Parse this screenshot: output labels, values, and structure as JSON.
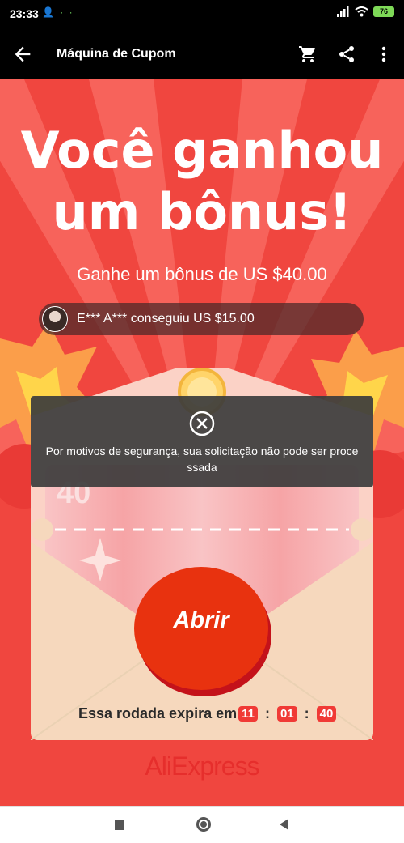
{
  "status_bar": {
    "time": "23:33",
    "notification_icons": "👤 · ·",
    "battery_level": "76"
  },
  "app_bar": {
    "title": "Máquina de Cupom",
    "back_icon": "arrow-left-icon",
    "cart_icon": "cart-icon",
    "share_icon": "share-icon",
    "more_icon": "more-vert-icon"
  },
  "hero": {
    "headline_line1": "Você ganhou",
    "headline_line2": "um bônus!",
    "subtitle": "Ganhe um bônus de US $40.00"
  },
  "ticker": {
    "message": "E*** A*** conseguiu US $15.00"
  },
  "coupon": {
    "value_partial": "40",
    "ghost_text": "... US $40.00"
  },
  "open_button": {
    "label": "Abrir"
  },
  "expiry": {
    "label": "Essa rodada expira em",
    "hours": "11",
    "minutes": "01",
    "seconds": "40",
    "separator": ":"
  },
  "brand": {
    "logo_text": "AliExpress"
  },
  "toast": {
    "icon": "close-circle-icon",
    "message": "Por motivos de segurança, sua solicitação não pode ser proce ssada"
  },
  "colors": {
    "background_red": "#f0463f",
    "button_red": "#e8320f",
    "timer_red": "#f03a36",
    "brand_red": "#e62e2c",
    "envelope_beige": "#f6d8bd"
  }
}
